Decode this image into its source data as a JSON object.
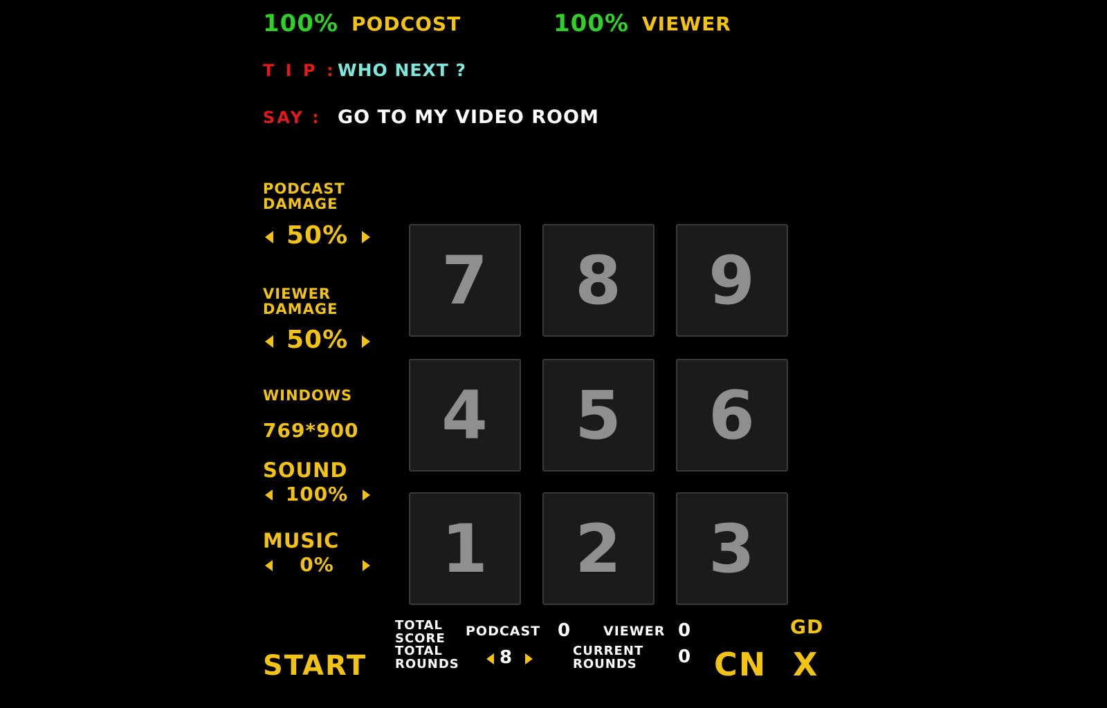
{
  "header": {
    "podcast_health": "100%",
    "podcast_label": "PODCOST",
    "viewer_health": "100%",
    "viewer_label": "VIEWER"
  },
  "tip": {
    "label": "T I P :",
    "text": "WHO NEXT ?"
  },
  "say": {
    "label": "SAY :",
    "text": "GO TO MY VIDEO ROOM"
  },
  "settings": {
    "podcast_damage": {
      "label_line1": "PODCAST",
      "label_line2": "DAMAGE",
      "value": "50%"
    },
    "viewer_damage": {
      "label_line1": "VIEWER",
      "label_line2": "DAMAGE",
      "value": "50%"
    },
    "windows": {
      "label": "WINDOWS",
      "value": "769*900"
    },
    "sound": {
      "label": "SOUND",
      "value": "100%"
    },
    "music": {
      "label": "MUSIC",
      "value": "0%"
    }
  },
  "keypad": {
    "rows": [
      [
        "7",
        "8",
        "9"
      ],
      [
        "4",
        "5",
        "6"
      ],
      [
        "1",
        "2",
        "3"
      ]
    ]
  },
  "footer": {
    "start_label": "START",
    "total_score_line1": "TOTAL",
    "total_score_line2": "SCORE",
    "podcast_label": "PODCAST",
    "podcast_score": "0",
    "viewer_label": "VIEWER",
    "viewer_score": "0",
    "total_rounds_line1": "TOTAL",
    "total_rounds_line2": "ROUNDS",
    "total_rounds_value": "8",
    "current_rounds_line1": "CURRENT",
    "current_rounds_line2": "ROUNDS",
    "current_rounds_value": "0",
    "gd_label": "GD",
    "cn_label": "CN",
    "close_label": "X"
  },
  "colors": {
    "background": "#000000",
    "health": "#2fd02a",
    "accent": "#f2c312",
    "tip_label": "#e21a1a",
    "tip_text": "#7ee8dc",
    "say_text": "#ffffff",
    "key_face": "#1b1b1b",
    "key_digit": "#8f8f8f"
  }
}
